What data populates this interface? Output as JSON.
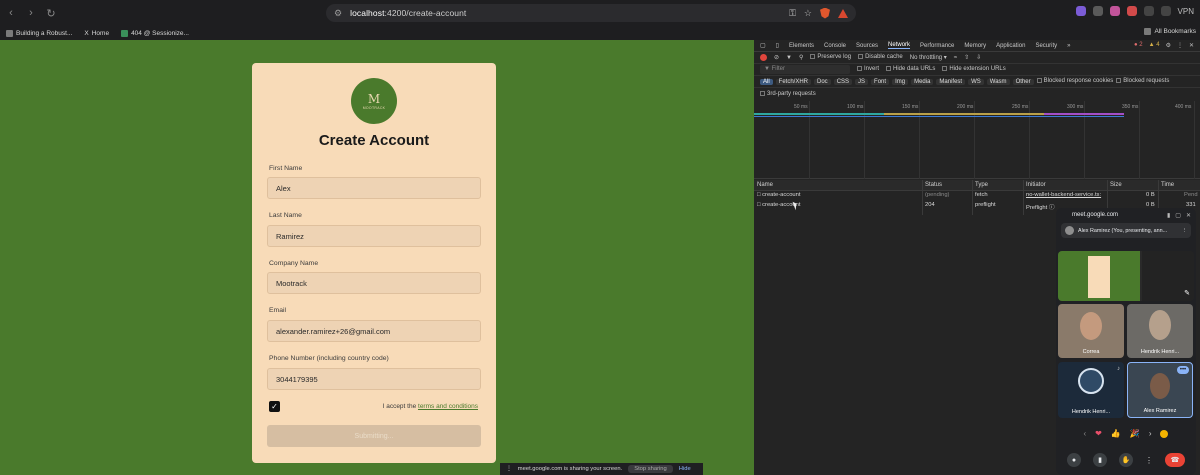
{
  "browser": {
    "url_host": "localhost",
    "url_path": ":4200/create-account",
    "vpn_label": "VPN",
    "bookmarks": [
      "Building a Robust...",
      "Home",
      "404 @ Sessionize..."
    ],
    "all_bookmarks": "All Bookmarks"
  },
  "form": {
    "logo_mark": "M",
    "logo_word": "MOOTRACK",
    "title": "Create Account",
    "first_name_label": "First Name",
    "first_name": "Alex",
    "last_name_label": "Last Name",
    "last_name": "Ramirez",
    "company_label": "Company Name",
    "company": "Mootrack",
    "email_label": "Email",
    "email": "alexander.ramirez+26@gmail.com",
    "phone_label": "Phone Number (including country code)",
    "phone": "3044179395",
    "accept_text": "I accept the",
    "terms_link": "terms and conditions",
    "submit_label": "Submitting..."
  },
  "share_bar": {
    "text": "meet.google.com is sharing your screen.",
    "stop": "Stop sharing",
    "hide": "Hide"
  },
  "devtools": {
    "tabs": [
      "Elements",
      "Console",
      "Sources",
      "Network",
      "Performance",
      "Memory",
      "Application",
      "Security"
    ],
    "active_tab": "Network",
    "errors": "2",
    "warnings": "4",
    "preserve_log": "Preserve log",
    "disable_cache": "Disable cache",
    "throttling": "No throttling",
    "filter_placeholder": "Filter",
    "invert": "Invert",
    "hide_data_urls": "Hide data URLs",
    "hide_ext_urls": "Hide extension URLs",
    "type_chips": [
      "All",
      "Fetch/XHR",
      "Doc",
      "CSS",
      "JS",
      "Font",
      "Img",
      "Media",
      "Manifest",
      "WS",
      "Wasm",
      "Other"
    ],
    "blocked_cookies": "Blocked response cookies",
    "blocked_requests": "Blocked requests",
    "third_party": "3rd-party requests",
    "timeline_ticks": [
      "50 ms",
      "100 ms",
      "150 ms",
      "200 ms",
      "250 ms",
      "300 ms",
      "350 ms",
      "400 ms"
    ],
    "columns": [
      "Name",
      "Status",
      "Type",
      "Initiator",
      "Size",
      "Time"
    ],
    "rows": [
      {
        "name": "create-account",
        "status": "(pending)",
        "type": "fetch",
        "initiator": "no-wallet-backend-service.ts:",
        "size": "0 B",
        "time": "Pend"
      },
      {
        "name": "create-account",
        "status": "204",
        "type": "preflight",
        "initiator": "Preflight",
        "size": "0 B",
        "time": "331"
      }
    ]
  },
  "meet": {
    "host": "meet.google.com",
    "presenting": "Alex Ramirez (You, presenting, ann...",
    "tiles": [
      "Correa",
      "Hendrik Henri...",
      "Hendrik Henri...",
      "Alex Ramirez"
    ],
    "reactions": [
      "❤",
      "👍",
      "🎉"
    ]
  },
  "colors": {
    "page_green": "#4a7a2c",
    "card_bg": "#f8dbb8",
    "end_call": "#ea4335"
  }
}
